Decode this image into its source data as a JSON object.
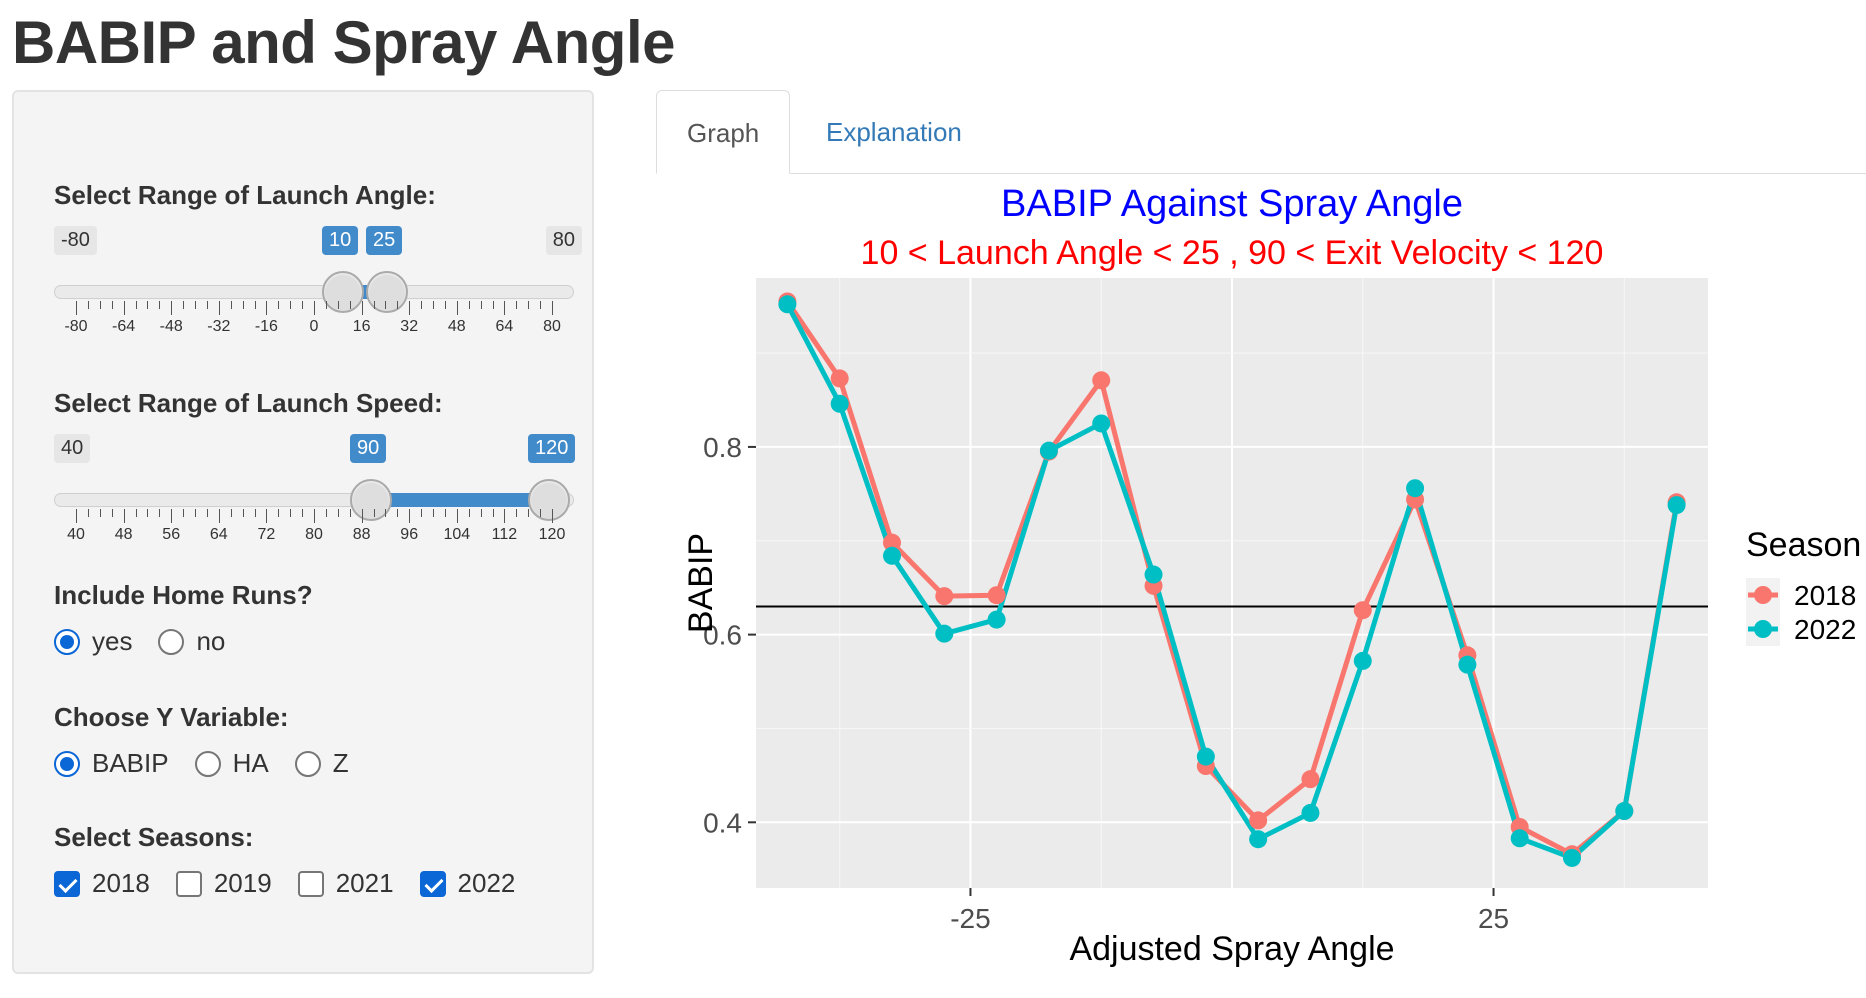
{
  "page": {
    "title": "BABIP and Spray Angle"
  },
  "sidebar": {
    "launch_angle": {
      "label": "Select Range of Launch Angle:",
      "min_label": "-80",
      "max_label": "80",
      "value_low": 10,
      "value_high": 25,
      "min": -80,
      "max": 80,
      "tick_labels": [
        "-80",
        "-64",
        "-48",
        "-32",
        "-16",
        "0",
        "16",
        "32",
        "48",
        "64",
        "80"
      ]
    },
    "launch_speed": {
      "label": "Select Range of Launch Speed:",
      "min_label": "40",
      "max_label": "",
      "value_low": 90,
      "value_high": 120,
      "min": 40,
      "max": 120,
      "tick_labels": [
        "40",
        "48",
        "56",
        "64",
        "72",
        "80",
        "88",
        "96",
        "104",
        "112",
        "120"
      ]
    },
    "home_runs": {
      "label": "Include Home Runs?",
      "options": [
        {
          "label": "yes",
          "selected": true
        },
        {
          "label": "no",
          "selected": false
        }
      ]
    },
    "y_variable": {
      "label": "Choose Y Variable:",
      "options": [
        {
          "label": "BABIP",
          "selected": true
        },
        {
          "label": "HA",
          "selected": false
        },
        {
          "label": "Z",
          "selected": false
        }
      ]
    },
    "seasons": {
      "label": "Select Seasons:",
      "options": [
        {
          "label": "2018",
          "checked": true
        },
        {
          "label": "2019",
          "checked": false
        },
        {
          "label": "2021",
          "checked": false
        },
        {
          "label": "2022",
          "checked": true
        }
      ]
    }
  },
  "tabs": [
    {
      "label": "Graph",
      "active": true
    },
    {
      "label": "Explanation",
      "active": false
    }
  ],
  "colors": {
    "accent": "#428bca",
    "title_blue": "#0000ff",
    "subtitle_red": "#ff0000",
    "panel_bg": "#ebebeb",
    "series_2018": "#f8766d",
    "series_2022": "#00bfc4"
  },
  "chart_data": {
    "type": "line",
    "title": "BABIP Against Spray Angle",
    "subtitle": "10  <  Launch Angle <  25 ,  90  <  Exit Velocity <  120",
    "xlabel": "Adjusted Spray Angle",
    "ylabel": "BABIP",
    "xlim": [
      -45.5,
      45.5
    ],
    "ylim": [
      0.33,
      0.98
    ],
    "x_ticks": [
      -25,
      25
    ],
    "y_ticks": [
      0.4,
      0.6,
      0.8
    ],
    "y_tick_labels": [
      "0.4",
      "0.6",
      "0.8"
    ],
    "x_tick_labels": [
      "-25",
      "25"
    ],
    "hline": 0.63,
    "grid": true,
    "legend": {
      "title": "Season",
      "placement": "right"
    },
    "x": [
      -42.5,
      -37.5,
      -32.5,
      -27.5,
      -22.5,
      -17.5,
      -12.5,
      -7.5,
      -2.5,
      2.5,
      7.5,
      12.5,
      17.5,
      22.5,
      27.5,
      32.5,
      37.5,
      42.5
    ],
    "series": [
      {
        "name": "2018",
        "color": "#f8766d",
        "values": [
          0.955,
          0.873,
          0.698,
          0.641,
          0.642,
          0.795,
          0.871,
          0.652,
          0.46,
          0.402,
          0.446,
          0.626,
          0.744,
          0.578,
          0.395,
          0.366,
          0.412,
          0.741
        ]
      },
      {
        "name": "2022",
        "color": "#00bfc4",
        "values": [
          0.952,
          0.846,
          0.684,
          0.601,
          0.616,
          0.796,
          0.825,
          0.664,
          0.47,
          0.382,
          0.41,
          0.572,
          0.756,
          0.568,
          0.383,
          0.362,
          0.412,
          0.738
        ]
      }
    ]
  }
}
